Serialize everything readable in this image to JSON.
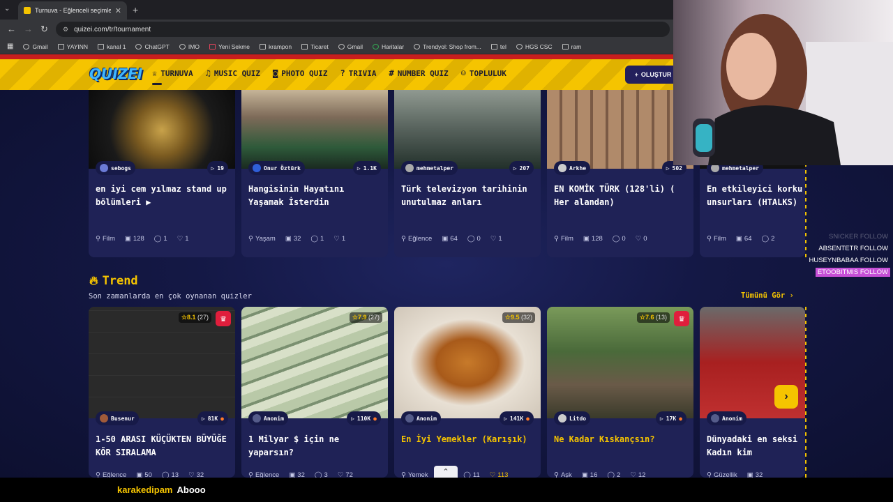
{
  "browser": {
    "tab_title": "Turnuva - Eğlenceli seçimler yap",
    "url": "quizei.com/tr/tournament",
    "bookmarks": [
      "Gmail",
      "YAYINN",
      "kanal 1",
      "ChatGPT",
      "IMO",
      "Yeni Sekme",
      "krampon",
      "Ticaret",
      "Gmail",
      "Haritalar",
      "Trendyol: Shop from...",
      "tel",
      "HGS CSC",
      "ram"
    ]
  },
  "site": {
    "logo": "QUIZEI",
    "nav": [
      "TURNUVA",
      "MUSIC QUIZ",
      "PHOTO QUIZ",
      "TRIVIA",
      "NUMBER QUIZ",
      "TOPLULUK"
    ],
    "create_label": "OLUŞTUR"
  },
  "top_cards": [
    {
      "author": "sebogs",
      "plays": "19",
      "title": "en iyi cem yılmaz stand up bölümleri ▶",
      "category": "Film",
      "count": "128",
      "comments": "1",
      "likes": "1"
    },
    {
      "author": "Onur Öztürk",
      "plays": "1.1K",
      "title": "Hangisinin Hayatını Yaşamak İsterdin",
      "category": "Yaşam",
      "count": "32",
      "comments": "1",
      "likes": "1"
    },
    {
      "author": "mehmetalper",
      "plays": "207",
      "title": "Türk televizyon tarihinin unutulmaz anları",
      "category": "Eğlence",
      "count": "64",
      "comments": "0",
      "likes": "1"
    },
    {
      "author": "Arkhe",
      "plays": "502",
      "title": "EN KOMİK TÜRK (128'li) ( Her alandan)",
      "category": "Film",
      "count": "128",
      "comments": "0",
      "likes": "0"
    },
    {
      "author": "mehmetalper",
      "plays": "",
      "title": "En etkileyici korku filmi unsurları (HTALKS)",
      "category": "Film",
      "count": "64",
      "comments": "2",
      "likes": ""
    }
  ],
  "trend": {
    "title": "Trend",
    "subtitle": "Son zamanlarda en çok oynanan quizler",
    "see_all": "Tümünü Gör ›",
    "cards": [
      {
        "rating": "8.1",
        "votes": "(27)",
        "author": "Busenur",
        "plays": "81K",
        "title": "1-50 ARASI KÜÇÜKTEN BÜYÜĞE KÖR SIRALAMA",
        "category": "Eğlence",
        "count": "50",
        "comments": "13",
        "likes": "32"
      },
      {
        "rating": "7.9",
        "votes": "(27)",
        "author": "Anonim",
        "plays": "110K",
        "title": "1 Milyar $ için ne yaparsın?",
        "category": "Eğlence",
        "count": "32",
        "comments": "3",
        "likes": "72"
      },
      {
        "rating": "9.5",
        "votes": "(32)",
        "author": "Anonim",
        "plays": "141K",
        "title": "En İyi Yemekler (Karışık)",
        "category": "Yemek",
        "count": "64",
        "comments": "11",
        "likes": "113"
      },
      {
        "rating": "7.6",
        "votes": "(13)",
        "author": "Litdo",
        "plays": "17K",
        "title": "Ne Kadar Kıskançsın?",
        "category": "Aşk",
        "count": "16",
        "comments": "2",
        "likes": "12"
      },
      {
        "rating": "",
        "votes": "",
        "author": "Anonim",
        "plays": "",
        "title": "Dünyadaki en seksi Kadın kim",
        "category": "Güzellik",
        "count": "32",
        "comments": "",
        "likes": ""
      }
    ]
  },
  "stream": {
    "follows": [
      "SNICKER FOLLOW",
      "ABSENTETR FOLLOW",
      "HUSEYNBABAA FOLLOW",
      "ETOOBITMIS FOLLOW"
    ],
    "chat_user": "karakedipam",
    "chat_msg": "Abooo"
  }
}
